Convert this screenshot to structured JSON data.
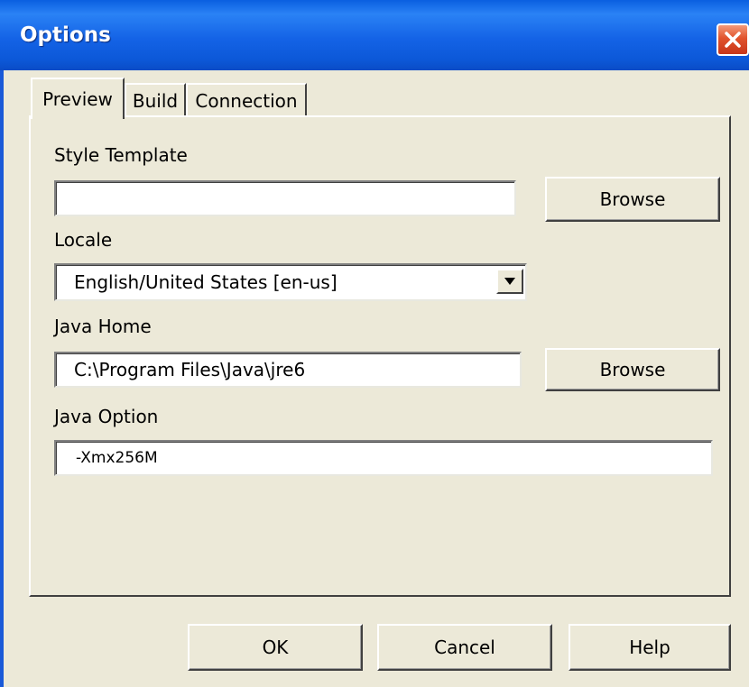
{
  "window": {
    "title": "Options"
  },
  "tabs": [
    {
      "label": "Preview",
      "active": true
    },
    {
      "label": "Build",
      "active": false
    },
    {
      "label": "Connection",
      "active": false
    }
  ],
  "preview": {
    "style_template": {
      "label": "Style Template",
      "value": "",
      "browse_label": "Browse"
    },
    "locale": {
      "label": "Locale",
      "selected": "English/United States [en-us]"
    },
    "java_home": {
      "label": "Java Home",
      "value": "C:\\Program Files\\Java\\jre6",
      "browse_label": "Browse"
    },
    "java_option": {
      "label": "Java Option",
      "value": "-Xmx256M"
    }
  },
  "footer": {
    "ok_label": "OK",
    "cancel_label": "Cancel",
    "help_label": "Help"
  },
  "colors": {
    "title_bar": "#1463e6",
    "close_button": "#e1532c",
    "dialog_bg": "#ece9d8"
  },
  "icons": {
    "close": "close-icon",
    "dropdown": "chevron-down-icon"
  }
}
